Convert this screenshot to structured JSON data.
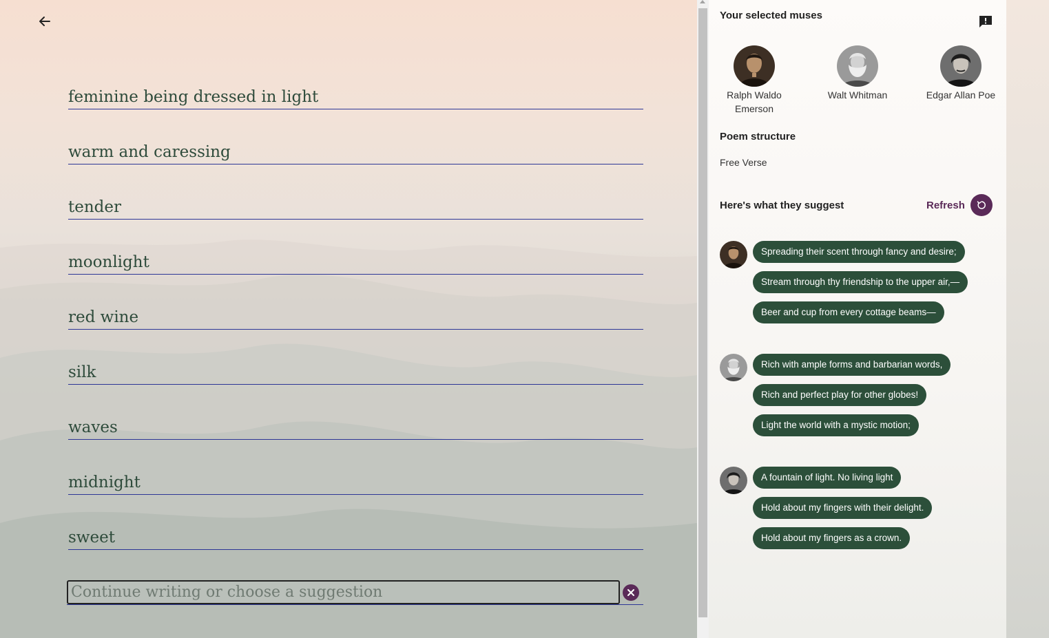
{
  "editor": {
    "back_icon": "arrow-left-icon",
    "lines": [
      "feminine being dressed in light",
      "warm and caressing",
      "tender",
      "moonlight",
      "red wine",
      "silk",
      "waves",
      "midnight",
      "sweet"
    ],
    "input": {
      "value": "",
      "placeholder": "Continue writing or choose a suggestion"
    },
    "clear_icon": "close-icon"
  },
  "panel": {
    "muses_heading": "Your selected muses",
    "feedback_icon": "feedback-icon",
    "muses": [
      {
        "name": "Ralph Waldo Emerson"
      },
      {
        "name": "Walt Whitman"
      },
      {
        "name": "Edgar Allan Poe"
      }
    ],
    "structure_heading": "Poem structure",
    "structure_value": "Free Verse",
    "suggest_heading": "Here's what they suggest",
    "refresh_label": "Refresh",
    "refresh_icon": "refresh-icon",
    "suggestions": [
      {
        "muse": "Ralph Waldo Emerson",
        "lines": [
          "Spreading their scent through fancy and desire;",
          "Stream through thy friendship to the upper air,—",
          "Beer and cup from every cottage beams—"
        ]
      },
      {
        "muse": "Walt Whitman",
        "lines": [
          "Rich with ample forms and barbarian words,",
          "Rich and perfect play for other globes!",
          "Light the world with a mystic motion;"
        ]
      },
      {
        "muse": "Edgar Allan Poe",
        "lines": [
          "A fountain of light. No living light",
          "Hold about my fingers with their delight.",
          "Hold about my fingers as a crown."
        ]
      }
    ]
  },
  "colors": {
    "accent": "#5a2a58",
    "chip": "#2c4f3a",
    "line_text": "#2e4b3b",
    "underline": "#2c3596"
  }
}
